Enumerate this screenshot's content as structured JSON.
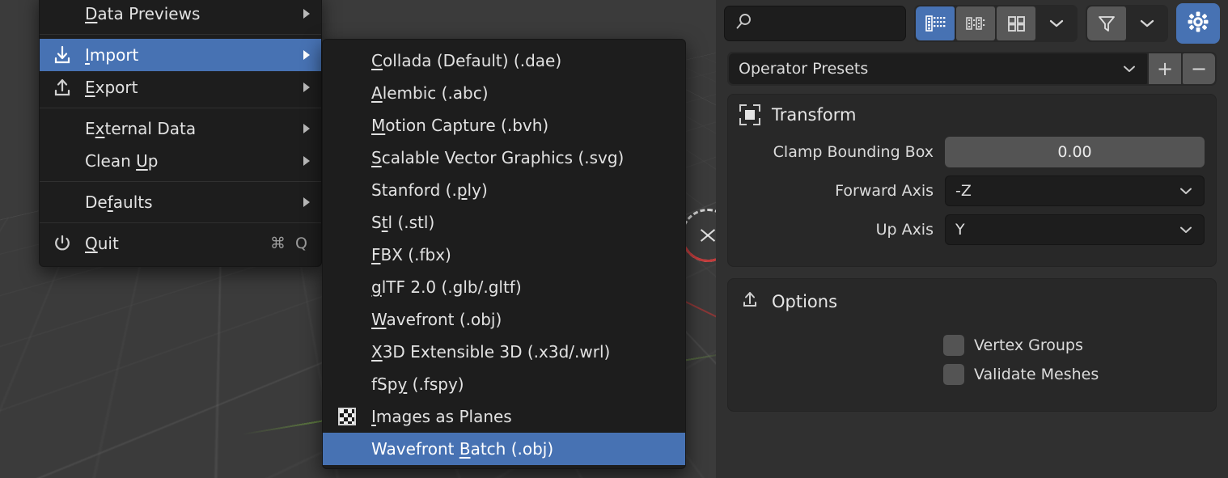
{
  "app": {
    "theme_accent": "#4772b3",
    "panel_bg": "#303030",
    "menu_bg": "#1d1d1d"
  },
  "file_menu": {
    "items": [
      {
        "label": "Data Previews",
        "accel": "D",
        "icon": "none",
        "submenu_arrow": true,
        "highlighted": false,
        "shortcut": ""
      },
      {
        "label": "Import",
        "accel": "I",
        "icon": "import-arrow-icon",
        "submenu_arrow": true,
        "highlighted": true,
        "shortcut": ""
      },
      {
        "label": "Export",
        "accel": "E",
        "icon": "export-arrow-icon",
        "submenu_arrow": true,
        "highlighted": false,
        "shortcut": ""
      },
      {
        "label": "External Data",
        "accel": "x",
        "icon": "none",
        "submenu_arrow": true,
        "highlighted": false,
        "shortcut": ""
      },
      {
        "label": "Clean Up",
        "accel": "U",
        "icon": "none",
        "submenu_arrow": true,
        "highlighted": false,
        "shortcut": ""
      },
      {
        "label": "Defaults",
        "accel": "f",
        "icon": "none",
        "submenu_arrow": true,
        "highlighted": false,
        "shortcut": ""
      },
      {
        "label": "Quit",
        "accel": "Q",
        "icon": "power-icon",
        "submenu_arrow": false,
        "highlighted": false,
        "shortcut": "⌘ Q"
      }
    ]
  },
  "import_submenu": {
    "items": [
      {
        "label": "Collada (Default) (.dae)",
        "icon": "none",
        "highlighted": false
      },
      {
        "label": "Alembic (.abc)",
        "icon": "none",
        "highlighted": false
      },
      {
        "label": "Motion Capture (.bvh)",
        "icon": "none",
        "highlighted": false
      },
      {
        "label": "Scalable Vector Graphics (.svg)",
        "icon": "none",
        "highlighted": false
      },
      {
        "label": "Stanford (.ply)",
        "icon": "none",
        "highlighted": false
      },
      {
        "label": "Stl (.stl)",
        "icon": "none",
        "highlighted": false
      },
      {
        "label": "FBX (.fbx)",
        "icon": "none",
        "highlighted": false
      },
      {
        "label": "glTF 2.0 (.glb/.gltf)",
        "icon": "none",
        "highlighted": false
      },
      {
        "label": "Wavefront (.obj)",
        "icon": "none",
        "highlighted": false
      },
      {
        "label": "X3D Extensible 3D (.x3d/.wrl)",
        "icon": "none",
        "highlighted": false
      },
      {
        "label": "fSpy (.fspy)",
        "icon": "none",
        "highlighted": false
      },
      {
        "label": "Images as Planes",
        "icon": "checker-icon",
        "highlighted": false
      },
      {
        "label": "Wavefront Batch (.obj)",
        "icon": "none",
        "highlighted": true
      }
    ]
  },
  "right_panel": {
    "search": {
      "value": "",
      "placeholder": "",
      "icon": "search-icon"
    },
    "view_modes": [
      {
        "name": "vertical-list",
        "active": true
      },
      {
        "name": "horizontal-list",
        "active": false
      },
      {
        "name": "thumbnails",
        "active": false
      },
      {
        "name": "display-dropdown",
        "active": false
      }
    ],
    "filter": {
      "icon": "funnel-icon",
      "active": true,
      "dropdown": true
    },
    "settings": {
      "icon": "gear-icon",
      "active": true
    },
    "presets": {
      "label": "Operator Presets",
      "add_label": "+",
      "remove_label": "−"
    },
    "transform_panel": {
      "title": "Transform",
      "icon": "bounding-box-icon",
      "rows": [
        {
          "label": "Clamp Bounding Box",
          "value": "0.00",
          "type": "number"
        },
        {
          "label": "Forward Axis",
          "value": "-Z",
          "type": "select"
        },
        {
          "label": "Up Axis",
          "value": "Y",
          "type": "select"
        }
      ]
    },
    "options_panel": {
      "title": "Options",
      "icon": "export-arrow-icon",
      "checkboxes": [
        {
          "label": "Vertex Groups",
          "checked": false
        },
        {
          "label": "Validate Meshes",
          "checked": false
        }
      ]
    }
  }
}
